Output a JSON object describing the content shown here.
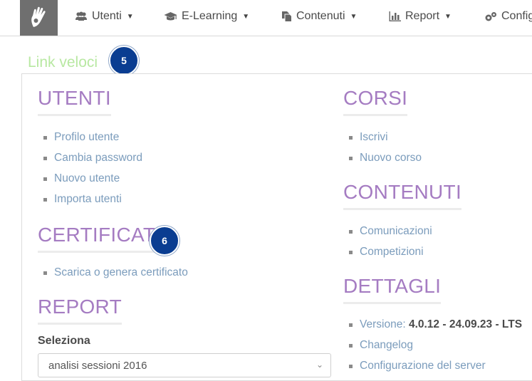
{
  "nav": {
    "items": [
      {
        "label": "Utenti",
        "icon": "users-icon"
      },
      {
        "label": "E-Learning",
        "icon": "graduation-cap-icon"
      },
      {
        "label": "Contenuti",
        "icon": "files-icon"
      },
      {
        "label": "Report",
        "icon": "bar-chart-icon"
      },
      {
        "label": "Config",
        "icon": "gears-icon"
      }
    ],
    "caret": "▼"
  },
  "quick_links": {
    "title": "Link veloci",
    "badge": "5"
  },
  "sections": {
    "utenti": {
      "title": "UTENTI",
      "links": [
        "Profilo utente",
        "Cambia password",
        "Nuovo utente",
        "Importa utenti"
      ]
    },
    "certificati": {
      "title": "CERTIFICATI",
      "badge": "6",
      "links": [
        "Scarica o genera certificato"
      ]
    },
    "report": {
      "title": "REPORT",
      "select_label": "Seleziona",
      "select_value": "analisi sessioni 2016"
    },
    "corsi": {
      "title": "CORSI",
      "links": [
        "Iscrivi",
        "Nuovo corso"
      ]
    },
    "contenuti": {
      "title": "CONTENUTI",
      "links": [
        "Comunicazioni",
        "Competizioni"
      ]
    },
    "dettagli": {
      "title": "DETTAGLI",
      "version_label": "Versione:",
      "version_value": "4.0.12 - 24.09.23 - LTS",
      "links": [
        "Changelog",
        "Configurazione del server"
      ]
    }
  },
  "colors": {
    "accent_title": "#a57cc2",
    "link": "#7b9cbc",
    "quick_links_title": "#b8e8a2",
    "badge": "#0a3d91",
    "logo_bg": "#6f6f6f"
  }
}
